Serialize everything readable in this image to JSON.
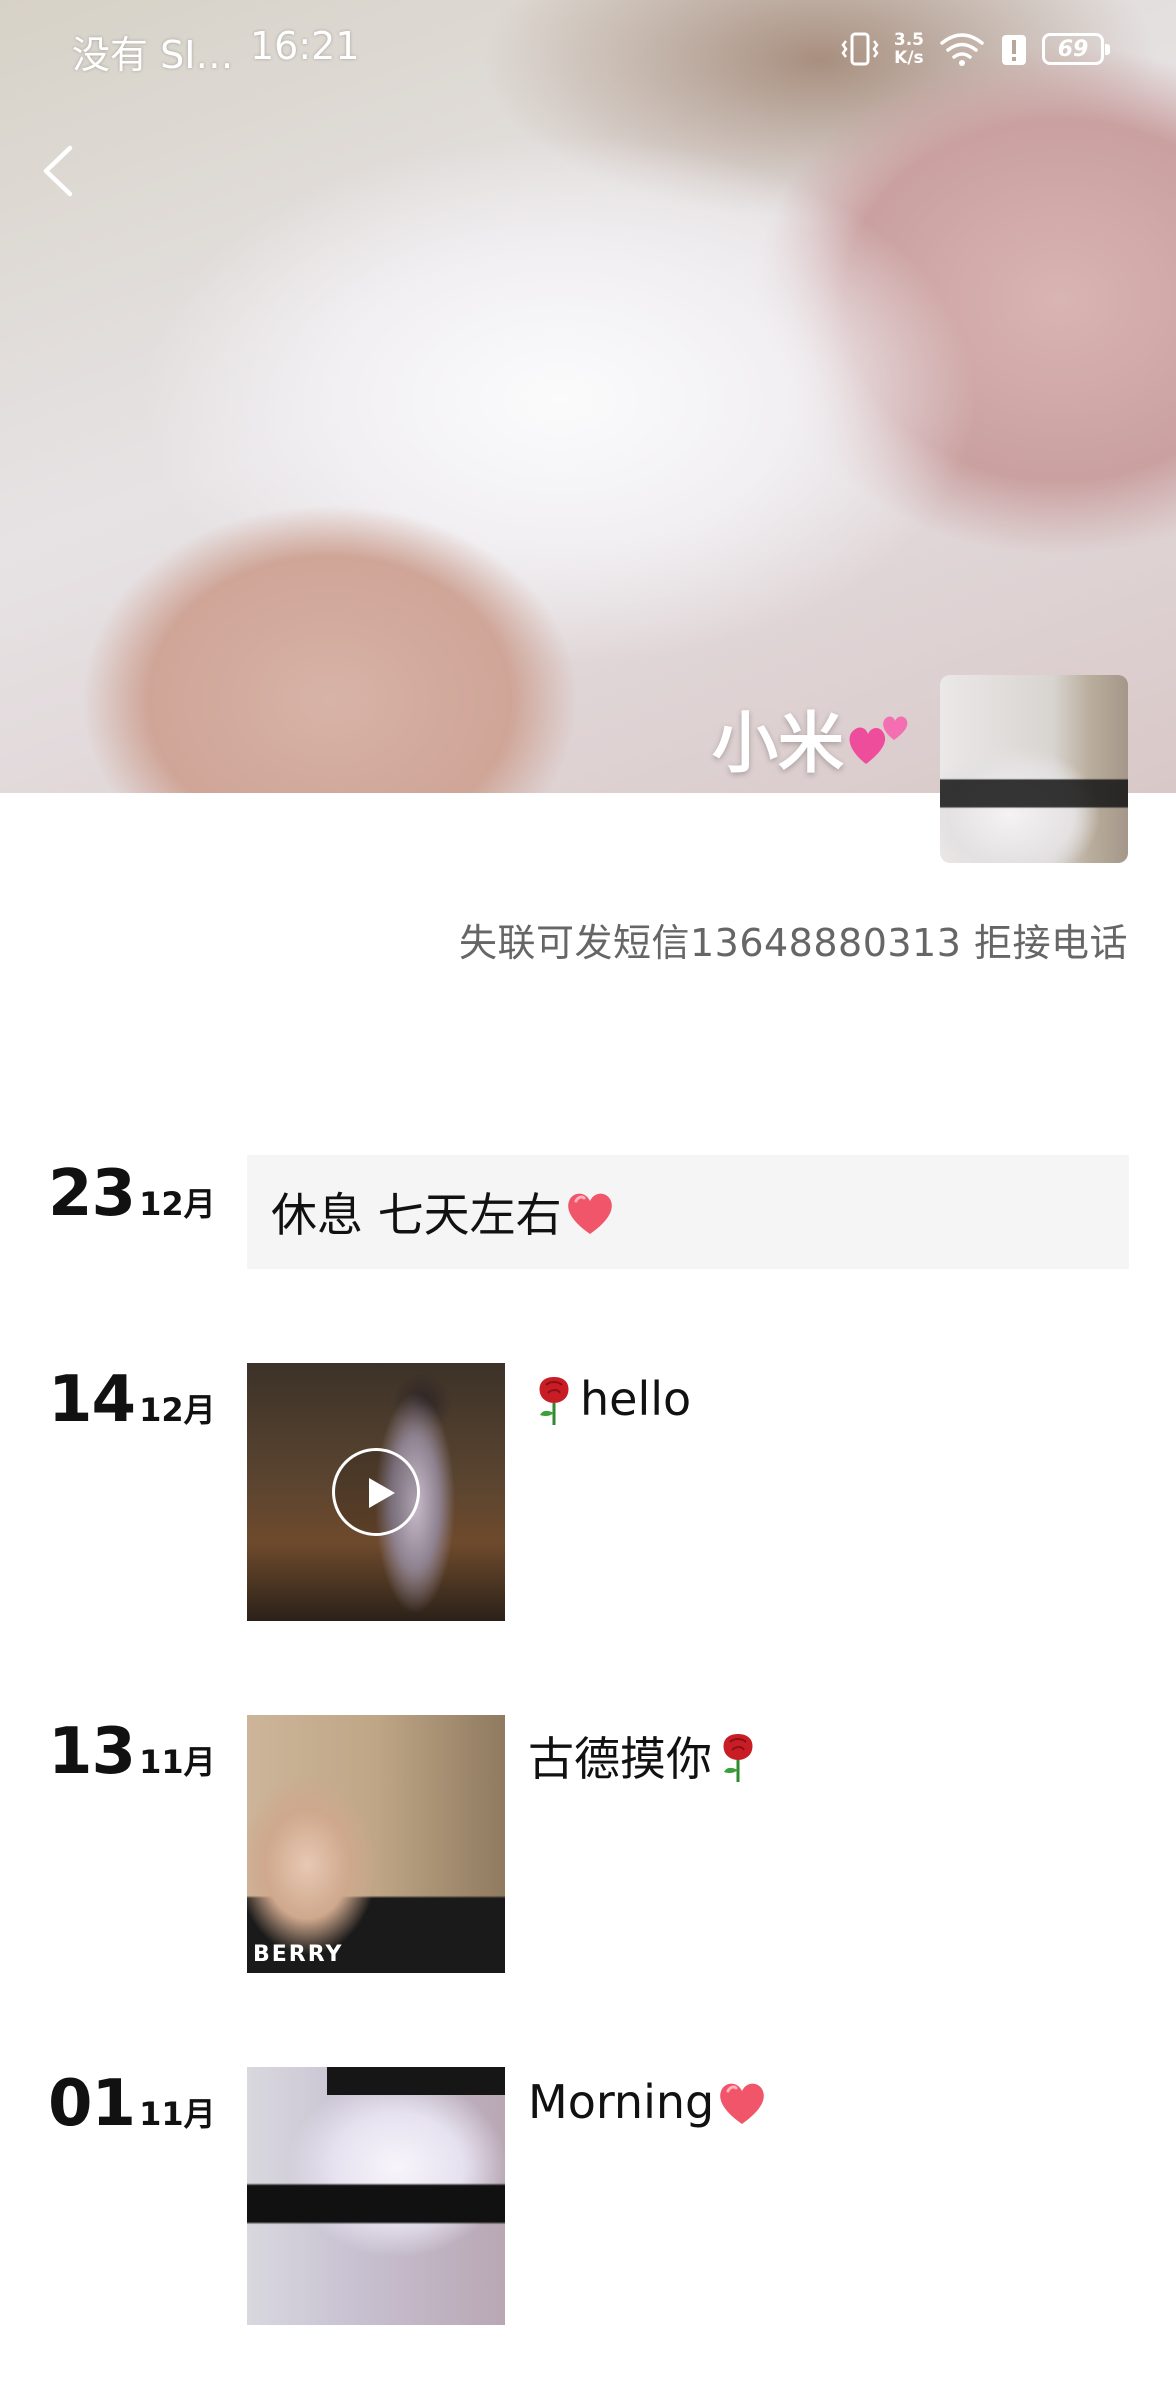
{
  "status_bar": {
    "carrier": "没有 SI…",
    "time": "16:21",
    "net_speed_value": "3.5",
    "net_speed_unit": "K/s",
    "battery": "69"
  },
  "profile": {
    "name": "小米",
    "bio": "失联可发短信13648880313 拒接电话"
  },
  "posts": [
    {
      "day": "23",
      "month": "12月",
      "text": "休息 七天左右"
    },
    {
      "day": "14",
      "month": "12月",
      "text": "hello"
    },
    {
      "day": "13",
      "month": "11月",
      "text": "古德摸你",
      "watermark": "BERRY"
    },
    {
      "day": "01",
      "month": "11月",
      "text": "Morning"
    }
  ],
  "icons": {
    "back": "chevron-left-icon",
    "name_emoji": "two-hearts-icon",
    "heart": "red-heart-icon",
    "rose": "rose-icon",
    "play": "play-icon"
  },
  "colors": {
    "text": "#111111",
    "bio": "#666666",
    "card_bg": "#f5f5f5",
    "heart": "#f0556a",
    "rose": "#c81d25"
  }
}
